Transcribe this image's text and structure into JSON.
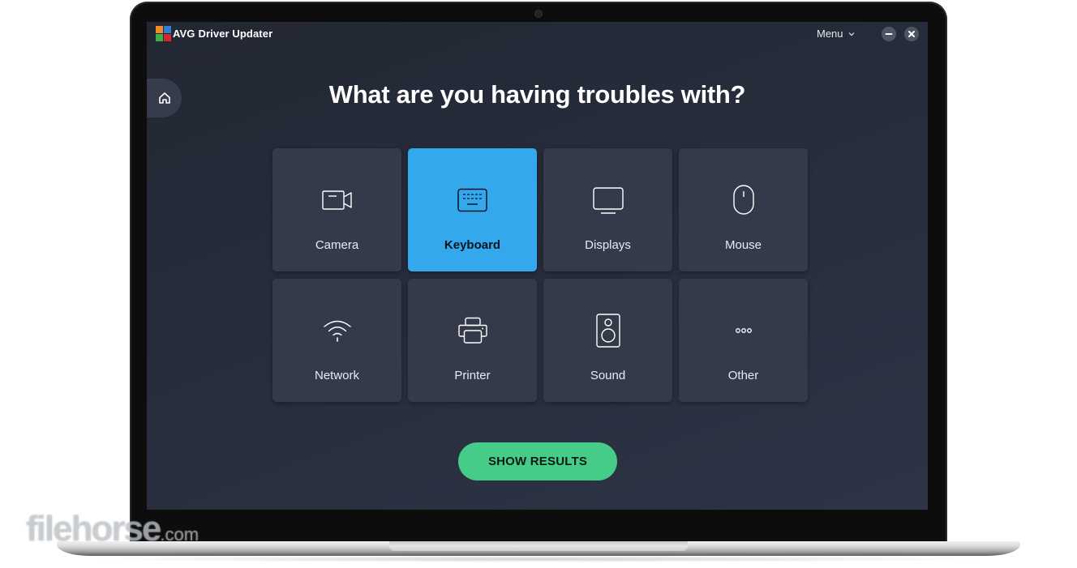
{
  "app": {
    "brand": "AVG",
    "title": "Driver Updater",
    "menu_label": "Menu",
    "minimize_icon": "minimize-icon",
    "close_icon": "close-icon",
    "home_icon": "home-icon"
  },
  "main": {
    "heading": "What are you having troubles with?",
    "categories": [
      {
        "label": "Camera",
        "icon": "camera-icon",
        "selected": false
      },
      {
        "label": "Keyboard",
        "icon": "keyboard-icon",
        "selected": true
      },
      {
        "label": "Displays",
        "icon": "display-icon",
        "selected": false
      },
      {
        "label": "Mouse",
        "icon": "mouse-icon",
        "selected": false
      },
      {
        "label": "Network",
        "icon": "wifi-icon",
        "selected": false
      },
      {
        "label": "Printer",
        "icon": "printer-icon",
        "selected": false
      },
      {
        "label": "Sound",
        "icon": "speaker-icon",
        "selected": false
      },
      {
        "label": "Other",
        "icon": "more-icon",
        "selected": false
      }
    ],
    "show_results_label": "SHOW RESULTS"
  },
  "colors": {
    "selected_tile": "#33a8ec",
    "tile": "#343a4a",
    "primary_button": "#45cc88",
    "background": "#262b38"
  },
  "watermark": {
    "text": "filehorse",
    "domain": ".com"
  }
}
